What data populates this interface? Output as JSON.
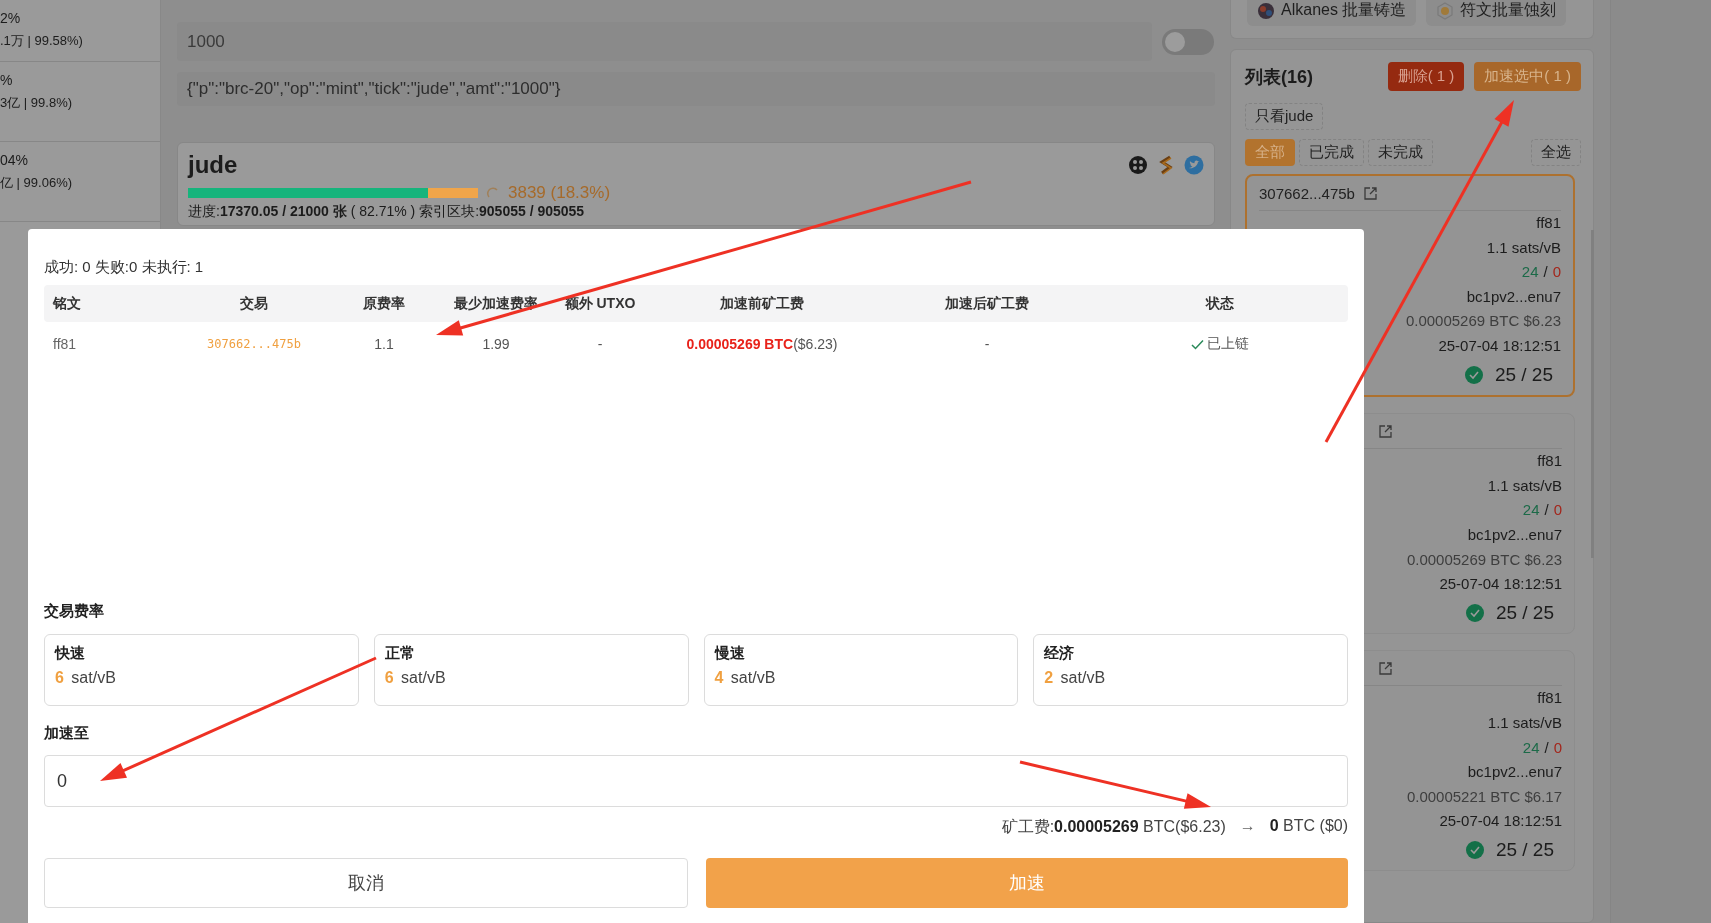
{
  "sidebar": [
    {
      "percent": "2%",
      "detail": ".1万 | 99.58%)"
    },
    {
      "percent": "%",
      "detail": "3亿 | 99.8%)"
    },
    {
      "percent": "04%",
      "detail": "亿 | 99.06%)"
    }
  ],
  "mint": {
    "amount": "1000",
    "toggle_on": false,
    "payload": "{\"p\":\"brc-20\",\"op\":\"mint\",\"tick\":\"jude\",\"amt\":\"1000\"}"
  },
  "token": {
    "name": "jude",
    "level": 0.8271,
    "remaining": "3839 (18.3%)",
    "progress": "进度:**17370.05 / 21000 张** ( 82.71% )  索引区块:**905055 / 905055**"
  },
  "right_tabs": [
    {
      "label": "Alkanes 批量铸造",
      "kind": "alkanes"
    },
    {
      "label": "符文批量蚀刻",
      "kind": "rune"
    }
  ],
  "list": {
    "title": "列表(16)",
    "actions": [
      {
        "label": "删除( 1 )",
        "kind": "danger"
      },
      {
        "label": "加速选中( 1 )",
        "kind": "warning"
      }
    ],
    "only_button": "只看jude",
    "filters": [
      {
        "label": "全部",
        "selected": true
      },
      {
        "label": "已完成",
        "selected": false
      },
      {
        "label": "未完成",
        "selected": false
      }
    ],
    "select_all": "全选",
    "items": [
      {
        "hash": "307662...475b",
        "selected": true,
        "inscription": "ff81",
        "rate": "1.1 sats/vB",
        "inputs_ok": "24",
        "inputs_sep": "/",
        "inputs_bad": "0",
        "address": "bc1pv2...enu7",
        "fee": "0.00005269 BTC $6.23",
        "time": "25-07-04 18:12:51",
        "confirmations": "25 / 25"
      },
      {
        "selected": false,
        "inscription": "ff81",
        "rate": "1.1 sats/vB",
        "inputs_ok": "24",
        "inputs_sep": "/",
        "inputs_bad": "0",
        "address": "bc1pv2...enu7",
        "fee": "0.00005269 BTC $6.23",
        "time": "25-07-04 18:12:51",
        "confirmations": "25 / 25"
      },
      {
        "selected": false,
        "inscription": "ff81",
        "rate": "1.1 sats/vB",
        "inputs_ok": "24",
        "inputs_sep": "/",
        "inputs_bad": "0",
        "address": "bc1pv2...enu7",
        "fee": "0.00005221 BTC $6.17",
        "time": "25-07-04 18:12:51",
        "confirmations": "25 / 25"
      }
    ]
  },
  "modal": {
    "summary": "成功: 0 失败:0 未执行: 1",
    "columns": [
      "铭文",
      "交易",
      "原费率",
      "最少加速费率",
      "额外 UTXO",
      "加速前矿工费",
      "加速后矿工费",
      "状态"
    ],
    "rows": [
      {
        "inscription": "ff81",
        "tx": "307662...475b",
        "rate": "1.1",
        "min_rate": "1.99",
        "extra_utxo": "-",
        "fee_before_btc": "0.00005269 BTC",
        "fee_before_usd": "($6.23)",
        "fee_after": "-",
        "status": "已上链",
        "status_ok": true
      }
    ],
    "fee_section_label": "交易费率",
    "fee_options": [
      {
        "name": "快速",
        "value": "6",
        "unit": "sat/vB"
      },
      {
        "name": "正常",
        "value": "6",
        "unit": "sat/vB"
      },
      {
        "name": "慢速",
        "value": "4",
        "unit": "sat/vB"
      },
      {
        "name": "经济",
        "value": "2",
        "unit": "sat/vB"
      }
    ],
    "speed_label": "加速至",
    "speed_value": "0",
    "fee_summary": "矿工费:**0.00005269** BTC($6.23)",
    "arrow": "→",
    "fee_result": "**0** BTC ($0)",
    "cancel": "取消",
    "confirm": "加速"
  }
}
